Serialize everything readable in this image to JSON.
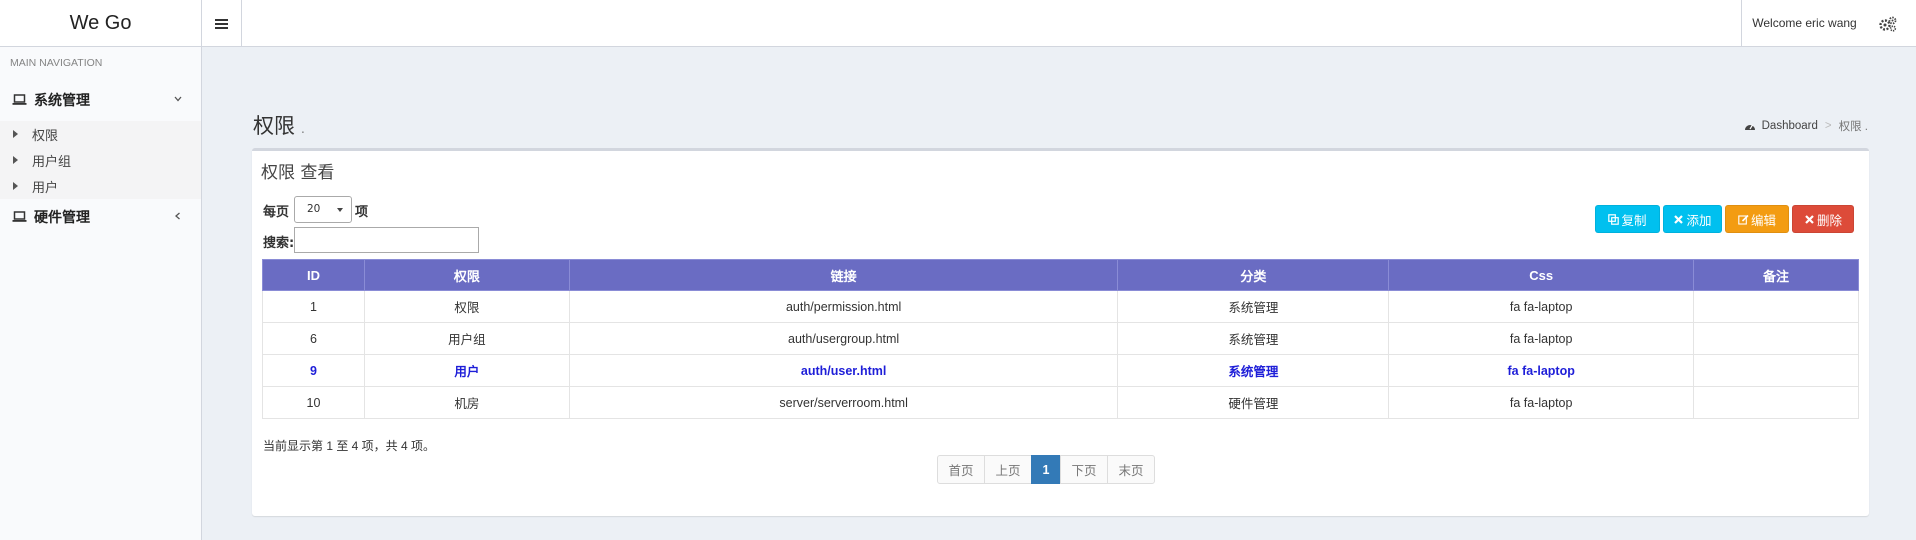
{
  "header": {
    "logo": "We Go",
    "welcome": "Welcome eric wang"
  },
  "sidebar": {
    "nav_header": "MAIN NAVIGATION",
    "menus": [
      {
        "label": "系统管理",
        "icon": "laptop-icon",
        "expanded": true,
        "items": [
          {
            "label": "权限"
          },
          {
            "label": "用户组"
          },
          {
            "label": "用户"
          }
        ]
      },
      {
        "label": "硬件管理",
        "icon": "laptop-icon",
        "expanded": false
      }
    ]
  },
  "page": {
    "title": "权限",
    "title_small": ".",
    "breadcrumb": {
      "home": "Dashboard",
      "current": "权限 ."
    }
  },
  "box": {
    "title": "权限 查看",
    "length_prefix": "每页",
    "length_value": "20",
    "length_suffix": "项",
    "search_label": "搜索:",
    "search_value": "",
    "buttons": {
      "copy": "复制",
      "add": "添加",
      "edit": "编辑",
      "delete": "删除"
    }
  },
  "table": {
    "headers": [
      "ID",
      "权限",
      "链接",
      "分类",
      "Css",
      "备注"
    ],
    "rows": [
      [
        "1",
        "权限",
        "auth/permission.html",
        "系统管理",
        "fa fa-laptop",
        ""
      ],
      [
        "6",
        "用户组",
        "auth/usergroup.html",
        "系统管理",
        "fa fa-laptop",
        ""
      ],
      [
        "9",
        "用户",
        "auth/user.html",
        "系统管理",
        "fa fa-laptop",
        ""
      ],
      [
        "10",
        "机房",
        "server/serverroom.html",
        "硬件管理",
        "fa fa-laptop",
        ""
      ]
    ],
    "highlighted_row": 2
  },
  "footer": {
    "info": "当前显示第 1 至 4 项，共 4 项。",
    "pager": {
      "first": "首页",
      "prev": "上页",
      "current": "1",
      "next": "下页",
      "last": "末页"
    }
  },
  "colors": {
    "table_header": "#6a6cc3",
    "highlight_text": "#1e1ed8",
    "info_button": "#00c0ef",
    "warning_button": "#f39c12",
    "danger_button": "#dd4b39",
    "pager_active": "#337ab7"
  }
}
